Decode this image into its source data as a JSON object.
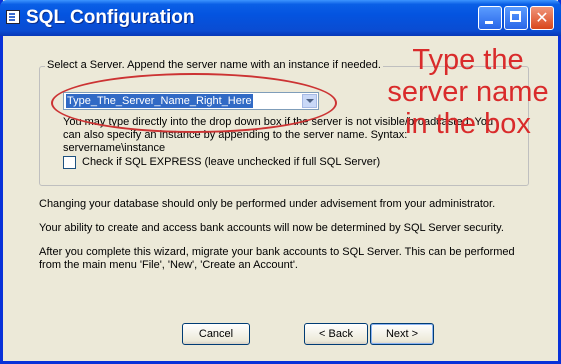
{
  "window": {
    "title": "SQL Configuration",
    "controls": {
      "minimize": "minimize",
      "maximize": "maximize",
      "close": "✕"
    }
  },
  "server_group": {
    "legend": "Select a Server.  Append the server name with an instance if needed.",
    "server_combo": {
      "value": "Type_The_Server_Name_Right_Here"
    },
    "help_text": "You may type directly into the drop down box if the server is not visible/broadcasted.  You can also specify an instance by appending to the server name.  Syntax: servername\\instance",
    "sql_express_checkbox": {
      "label": "Check if SQL EXPRESS (leave unchecked if full SQL Server)",
      "checked": false
    }
  },
  "paragraphs": [
    "Changing your database should only be performed under advisement from your administrator.",
    "Your ability to create and access bank accounts will now be determined by SQL Server security.",
    "After you complete this wizard, migrate your bank accounts to SQL Server.  This can be performed from the main menu 'File', 'New', 'Create an Account'."
  ],
  "annotation": {
    "text": "Type the server name in the box",
    "color": "#d92b2b"
  },
  "buttons": {
    "cancel": "Cancel",
    "back": "< Back",
    "next": "Next >"
  }
}
